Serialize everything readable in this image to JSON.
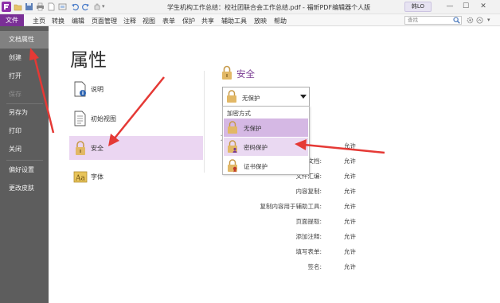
{
  "titlebar": {
    "title": "学生机构工作总结：校社团联合会工作总结.pdf - 福昕PDF编辑器个人版",
    "user": "韩LO"
  },
  "menubar": {
    "file": "文件",
    "items": [
      "主页",
      "转换",
      "编辑",
      "页面管理",
      "注释",
      "视图",
      "表单",
      "保护",
      "共享",
      "辅助工具",
      "放映",
      "帮助"
    ],
    "search_placeholder": "查找"
  },
  "sidebar": {
    "items": [
      {
        "label": "文档属性",
        "state": "active"
      },
      {
        "label": "创建",
        "state": "normal"
      },
      {
        "label": "打开",
        "state": "normal"
      },
      {
        "label": "保存",
        "state": "disabled"
      },
      {
        "label": "另存为",
        "state": "normal"
      },
      {
        "label": "打印",
        "state": "normal"
      },
      {
        "label": "关闭",
        "state": "normal"
      },
      {
        "label": "偏好设置",
        "state": "normal"
      },
      {
        "label": "更改皮肤",
        "state": "normal"
      }
    ]
  },
  "main": {
    "heading": "属性",
    "categories": [
      {
        "label": "说明",
        "icon": "document-info-icon"
      },
      {
        "label": "初始视图",
        "icon": "document-view-icon"
      },
      {
        "label": "安全",
        "icon": "lock-icon",
        "selected": true
      },
      {
        "label": "字体",
        "icon": "font-icon"
      }
    ],
    "security": {
      "heading": "安全",
      "dropdown_value": "无保护",
      "popup": {
        "header": "加密方式",
        "options": [
          {
            "label": "无保护",
            "icon": "lock-icon",
            "state": "selected"
          },
          {
            "label": "密码保护",
            "icon": "lock-user-icon",
            "state": "hover"
          },
          {
            "label": "证书保护",
            "icon": "lock-certificate-icon",
            "state": "normal"
          }
        ]
      },
      "peek": "文",
      "permissions": [
        {
          "label": "",
          "value": "允许"
        },
        {
          "label": "文档:",
          "value": "允许"
        },
        {
          "label": "文件汇编:",
          "value": "允许"
        },
        {
          "label": "内容复制:",
          "value": "允许"
        },
        {
          "label": "复制内容用于辅助工具:",
          "value": "允许"
        },
        {
          "label": "页面提取:",
          "value": "允许"
        },
        {
          "label": "添加注释:",
          "value": "允许"
        },
        {
          "label": "填写表单:",
          "value": "允许"
        },
        {
          "label": "签名:",
          "value": "允许"
        }
      ]
    }
  },
  "colors": {
    "brand": "#7a2f96",
    "sidebar_bg": "#5d5d5d",
    "selected_bg": "#ebd6f2",
    "annotation_arrow": "#e53935"
  }
}
